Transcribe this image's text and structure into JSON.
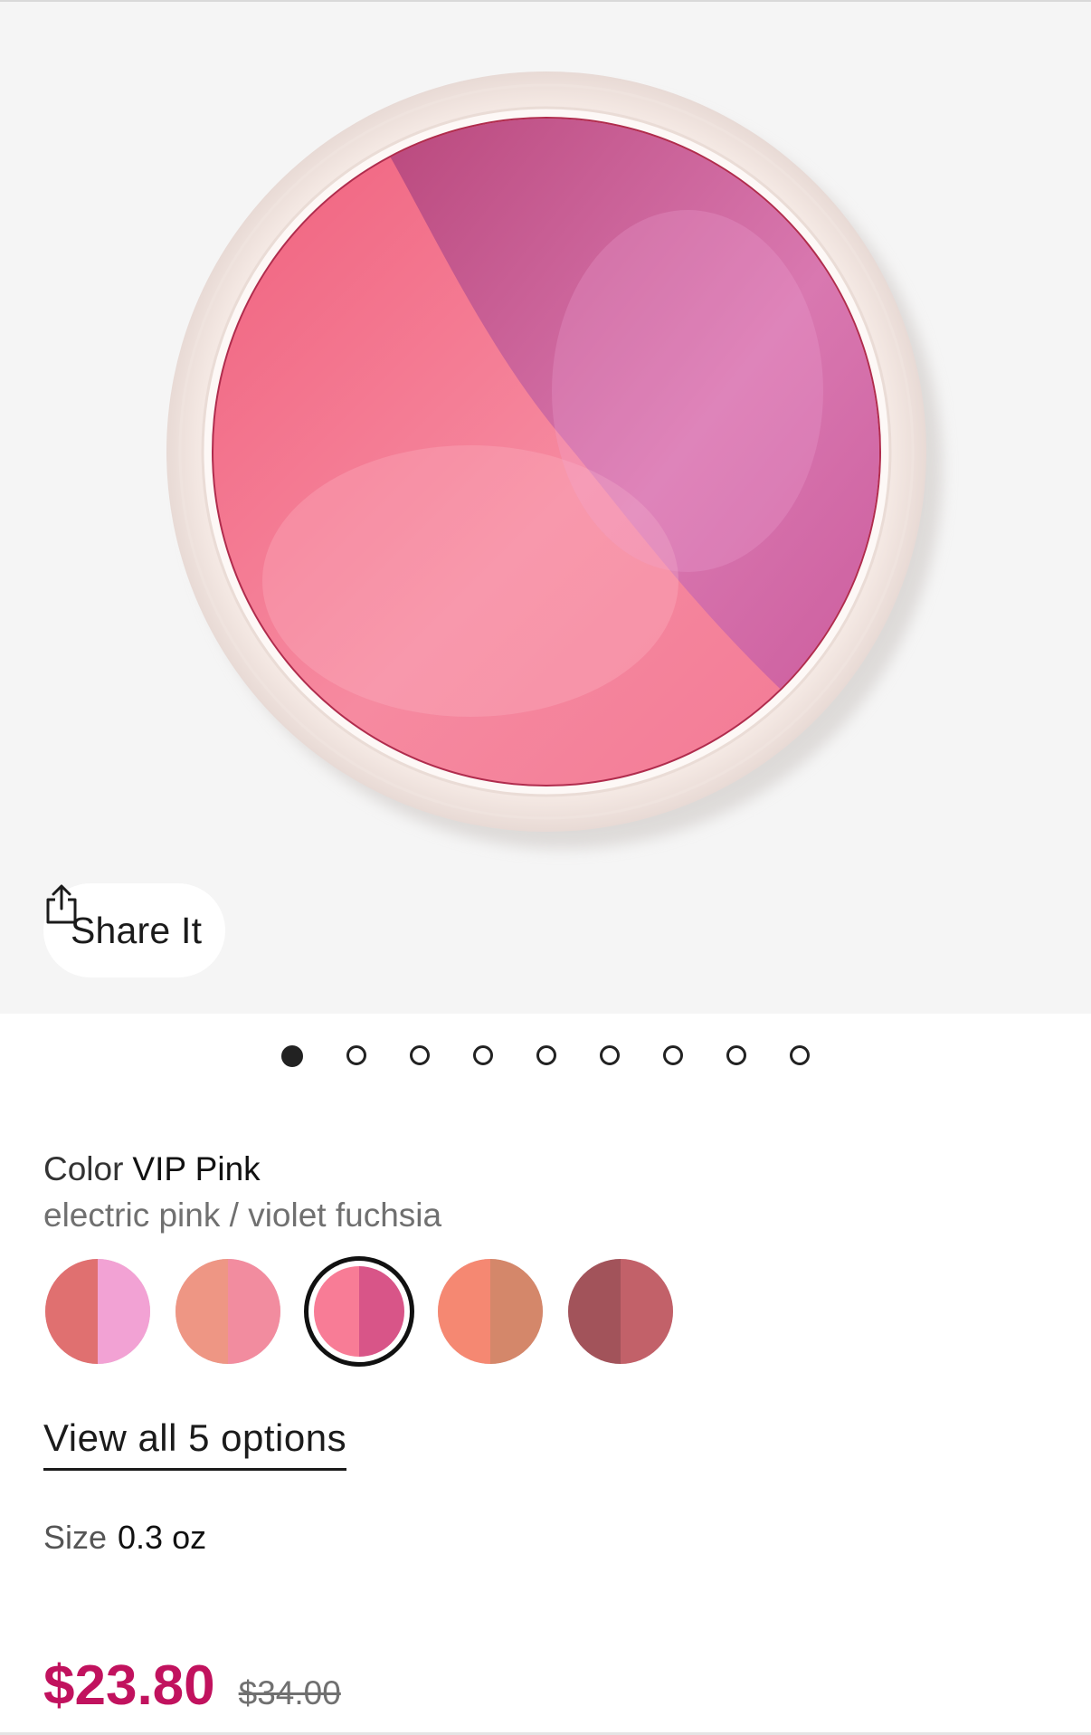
{
  "gallery": {
    "image_alt": "Blush compact with electric pink and violet fuchsia halves",
    "share_label": "Share It",
    "share_icon": "share-icon",
    "dot_count": 9,
    "active_dot": 1
  },
  "color": {
    "label": "Color",
    "name": "VIP Pink",
    "description": "electric pink / violet fuchsia",
    "swatches": [
      {
        "left": "#e07070",
        "right": "#f2a2d4",
        "selected": false
      },
      {
        "left": "#ee9684",
        "right": "#f28c9f",
        "selected": false
      },
      {
        "left": "#f87c96",
        "right": "#d85588",
        "selected": true
      },
      {
        "left": "#f58872",
        "right": "#d4876a",
        "selected": false
      },
      {
        "left": "#a2535a",
        "right": "#c26169",
        "selected": false
      }
    ],
    "view_all_label": "View all 5 options"
  },
  "size": {
    "label": "Size",
    "value": "0.3 oz"
  },
  "price": {
    "current": "$23.80",
    "original": "$34.00"
  },
  "colors": {
    "price_accent": "#c1125e",
    "hero_background": "#f5f5f5"
  }
}
